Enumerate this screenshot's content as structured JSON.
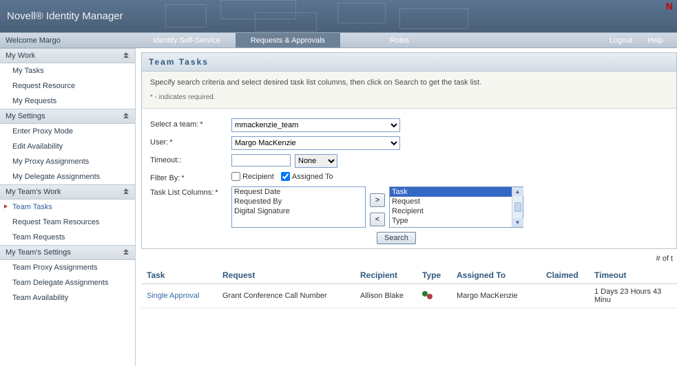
{
  "banner_title": "Novell® Identity Manager",
  "welcome": "Welcome Margo",
  "nav": {
    "self_service": "Identity Self-Service",
    "requests": "Requests & Approvals",
    "roles": "Roles",
    "logout": "Logout",
    "help": "Help"
  },
  "sidebar": {
    "groups": [
      {
        "title": "My Work",
        "items": [
          "My Tasks",
          "Request Resource",
          "My Requests"
        ]
      },
      {
        "title": "My Settings",
        "items": [
          "Enter Proxy Mode",
          "Edit Availability",
          "My Proxy Assignments",
          "My Delegate Assignments"
        ]
      },
      {
        "title": "My Team's Work",
        "items": [
          "Team Tasks",
          "Request Team Resources",
          "Team Requests"
        ],
        "active_index": 0
      },
      {
        "title": "My Team's Settings",
        "items": [
          "Team Proxy Assignments",
          "Team Delegate Assignments",
          "Team Availability"
        ]
      }
    ]
  },
  "panel": {
    "title": "Team Tasks",
    "intro": "Specify search criteria and select desired task list columns, then click on Search to get the task list.",
    "required_note": "* - indicates required."
  },
  "form": {
    "select_team_label": "Select a team:",
    "select_team_value": "mmackenzie_team",
    "user_label": "User:",
    "user_value": "Margo MacKenzie",
    "timeout_label": "Timeout::",
    "timeout_value": "",
    "timeout_unit": "None",
    "filter_by_label": "Filter By:",
    "filter_recipient_label": "Recipient",
    "filter_recipient_checked": false,
    "filter_assigned_label": "Assigned To",
    "filter_assigned_checked": true,
    "tlc_label": "Task List Columns:",
    "tlc_available": [
      "Request Date",
      "Requested By",
      "Digital Signature"
    ],
    "tlc_selected": [
      "Task",
      "Request",
      "Recipient",
      "Type"
    ],
    "move_right": ">",
    "move_left": "<",
    "search_btn": "Search"
  },
  "results": {
    "count_label": "# of t",
    "headers": {
      "task": "Task",
      "request": "Request",
      "recipient": "Recipient",
      "type": "Type",
      "assigned_to": "Assigned To",
      "claimed": "Claimed",
      "timeout": "Timeout"
    },
    "rows": [
      {
        "task": "Single Approval",
        "request": "Grant Conference Call Number",
        "recipient": "Allison Blake",
        "assigned_to": "Margo MacKenzie",
        "claimed": "",
        "timeout": "1 Days 23 Hours 43 Minu"
      }
    ]
  }
}
